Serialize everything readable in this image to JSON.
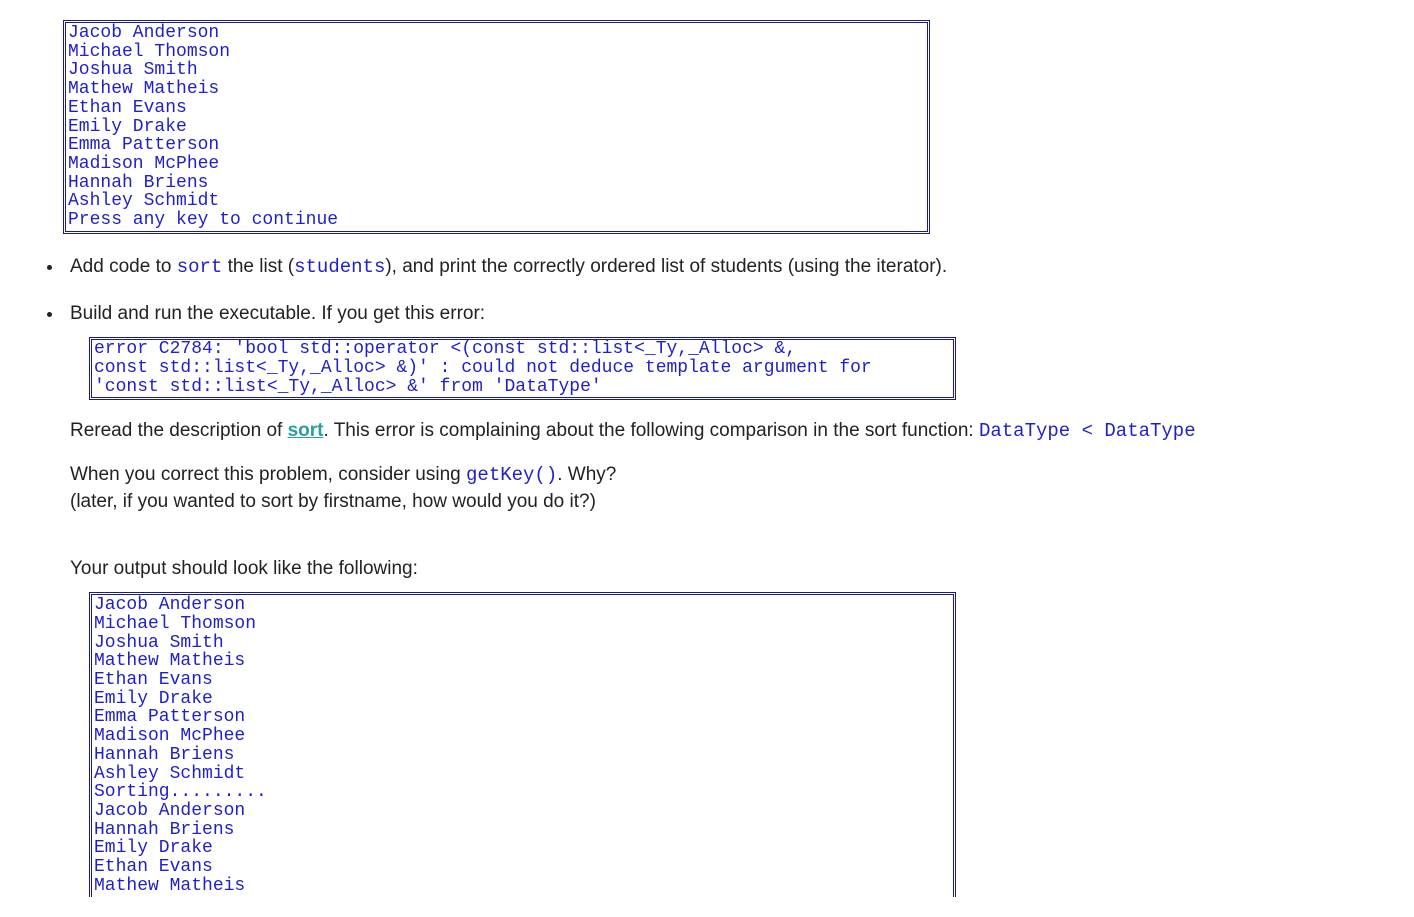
{
  "output1": "Jacob Anderson\nMichael Thomson\nJoshua Smith\nMathew Matheis\nEthan Evans\nEmily Drake\nEmma Patterson\nMadison McPhee\nHannah Briens\nAshley Schmidt\nPress any key to continue",
  "bullets": {
    "b1": {
      "pre": "Add code to ",
      "sort": "sort",
      "mid": " the list (",
      "students": "students",
      "post": "), and print the correctly ordered list of students (using the iterator)."
    },
    "b2": "Build and run the executable. If you get this error:"
  },
  "error_text": "error C2784: 'bool std::operator <(const std::list<_Ty,_Alloc> &,\nconst std::list<_Ty,_Alloc> &)' : could not deduce template argument for\n'const std::list<_Ty,_Alloc> &' from 'DataType'",
  "para1": {
    "pre": "Reread the description of ",
    "sort_link": "sort",
    "mid": ". This error is complaining about the following comparison in the sort function: ",
    "cmp": "DataType < DataType"
  },
  "para2": {
    "pre": "When you correct this problem, consider using ",
    "getkey": "getKey()",
    "post": ". Why?"
  },
  "para3": "(later, if you wanted to sort by firstname, how would you do it?)",
  "para4": "Your output should look like the following:",
  "output2": "Jacob Anderson\nMichael Thomson\nJoshua Smith\nMathew Matheis\nEthan Evans\nEmily Drake\nEmma Patterson\nMadison McPhee\nHannah Briens\nAshley Schmidt\nSorting.........\nJacob Anderson\nHannah Briens\nEmily Drake\nEthan Evans\nMathew Matheis"
}
